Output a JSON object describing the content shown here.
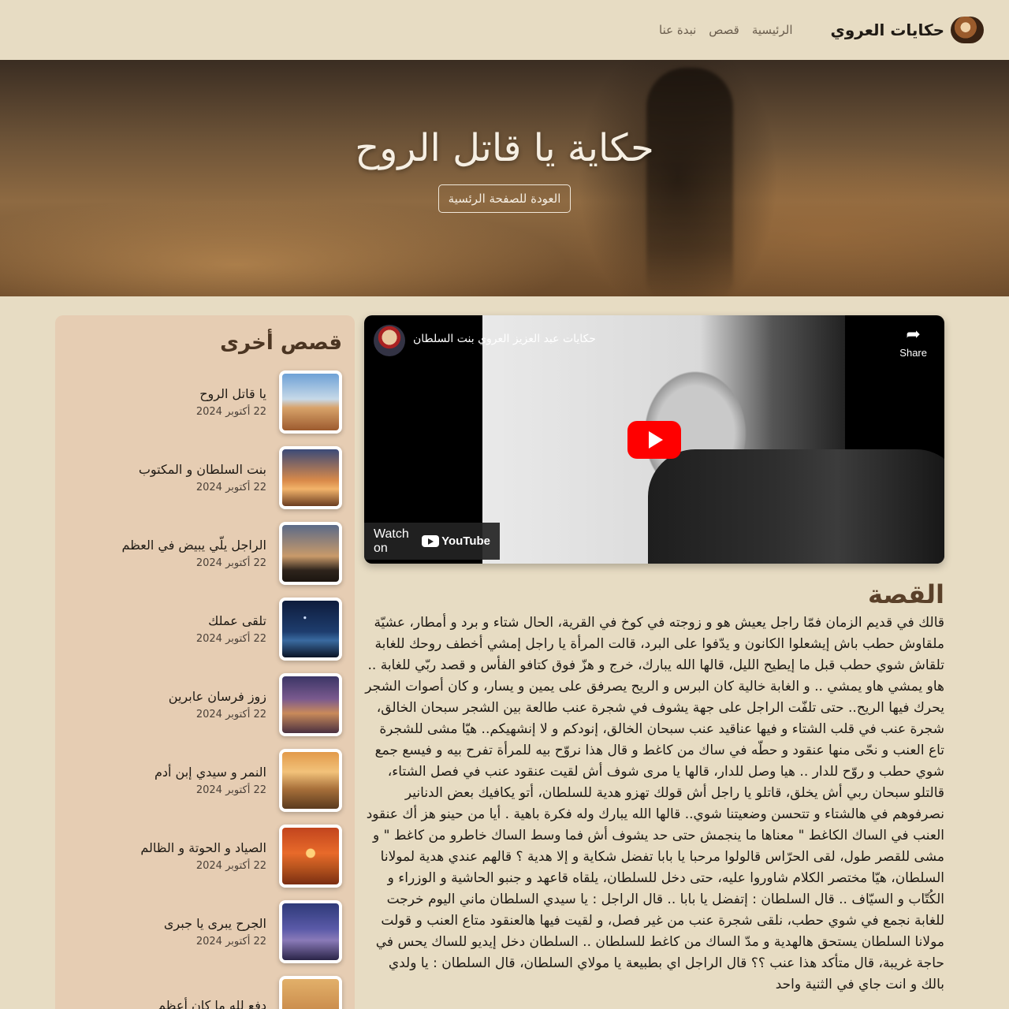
{
  "nav": {
    "brand": "حكايات العروي",
    "links": [
      "الرئيسية",
      "قصص",
      "نبدة عنا"
    ]
  },
  "hero": {
    "title": "حكاية يا قاتل الروح",
    "button": "العودة للصفحة الرئسية"
  },
  "video": {
    "title": "حكايات عبد العزيز العروي بنت السلطان",
    "share_label": "Share",
    "watch_on": "Watch on",
    "youtube": "YouTube"
  },
  "story": {
    "heading": "القصة",
    "text": "قالك في قديم الزمان فمّا راجل يعيش هو و زوجته في كوخ في القرية، الحال شتاء و برد و أمطار، عشيّة ملقاوش حطب باش إيشعلوا الكانون و يدّفوا على البرد، قالت المرأة يا راجل إمشي أخطف روحك للغابة تلقاش شوي حطب قبل ما إيطيح الليل، قالها الله يبارك، خرج و هزّ فوق كتافو الفأس و قصد ربّي للغابة .. هاو يمشي هاو يمشي .. و الغابة خالية كان البرس و الريح يصرفق على يمين و يسار، و كان أصوات الشجر يحرك فيها الريح.. حتى تلفّت الراجل على جهة يشوف في شجرة عنب طالعة بين الشجر سبحان الخالق، شجرة عنب في قلب الشتاء و فيها عناقيد عنب سبحان الخالق، إنودكم و لا إنشهيكم.. هيّا مشى للشجرة تاع العنب و نحّى منها عنقود و حطّه في ساك من كاغط و قال هذا نروّح بيه للمرأة تفرح بيه و فيسع جمع شوي حطب و روّح للدار .. هيا وصل للدار، قالها يا مرى شوف أش لقيت عنقود عنب في فصل الشتاء، قالتلو سبحان ربي أش يخلق، قاتلو يا راجل أش قولك تهزو هدية للسلطان، أتو يكافيك بعض الدنانير نصرفوهم في هالشتاء و تتحسن وضعيتنا شوي.. قالها الله يبارك وله فكرة باهية . أيا من حينو هز أك عنقود العنب في الساك الكاغط \" معناها ما ينجمش حتى حد يشوف أش فما وسط الساك خاطرو من كاغط \" و مشى للقصر طول، لقى الحرّاس قالولوا مرحبا يا بابا تفضل شكاية و إلا هدية ؟ قالهم عندي هدية لمولانا السلطان، هيّا مختصر الكلام شاوروا عليه، حتى دخل للسلطان، يلقاه قاعهد و جنبو الحاشية و الوزراء و الكُتّاب و السيّاف .. قال السلطان : إتفضل يا بابا .. قال الراجل : يا سيدي السلطان ماني اليوم خرجت للغابة نجمع في شوي حطب، نلقى شجرة عنب من غير فصل، و لقيت فيها هالعنقود متاع العنب و قولت مولانا السلطان يستحق هالهدية و مدّ الساك من كاغط للسلطان .. السلطان دخل إيديو للساك يحس في حاجة غريبة، قال متأكد هذا عنب ؟؟ قال الراجل اي بطبيعة يا مولاي السلطان، قال السلطان : يا ولدي بالك و انت جاي في الثنية واحد"
  },
  "sidebar": {
    "heading": "قصص أخرى",
    "items": [
      {
        "title": "يا قاتل الروح",
        "date": "22 أكتوبر 2024"
      },
      {
        "title": "بنت السلطان و المكتوب",
        "date": "22 أكتوبر 2024"
      },
      {
        "title": "الراجل يلّي يبيض في العظم",
        "date": "22 أكتوبر 2024"
      },
      {
        "title": "تلقى عملك",
        "date": "22 أكتوبر 2024"
      },
      {
        "title": "زوز فرسان عابرين",
        "date": "22 أكتوبر 2024"
      },
      {
        "title": "النمر و سيدي إبن أدم",
        "date": "22 أكتوبر 2024"
      },
      {
        "title": "الصياد و الحوتة و الظالم",
        "date": "22 أكتوبر 2024"
      },
      {
        "title": "الجرح يبرى يا جبرى",
        "date": "22 أكتوبر 2024"
      },
      {
        "title": "دفع لله ما كان أعظم",
        "date": ""
      }
    ]
  },
  "colors": {
    "page_bg": "#e7dcc3",
    "sidebar_bg": "#e6cdb3",
    "heading_brown": "#5a4029",
    "youtube_red": "#ff0000"
  }
}
